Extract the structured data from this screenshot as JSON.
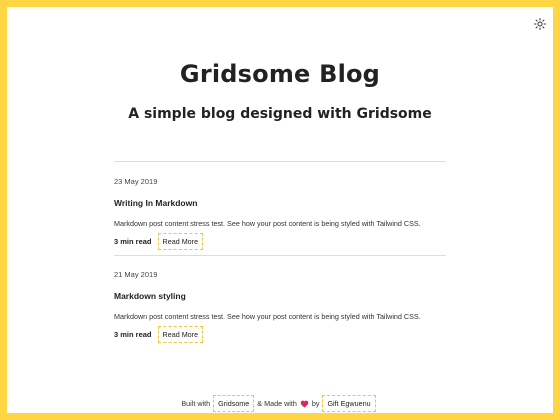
{
  "header": {
    "title": "Gridsome Blog",
    "subtitle": "A simple blog designed with Gridsome",
    "theme_toggle_icon": "sun-icon"
  },
  "posts": [
    {
      "date": "23 May 2019",
      "title": "Writing In Markdown",
      "excerpt": "Markdown post content stress test. See how your post content is being styled with Tailwind CSS.",
      "read_time": "3 min read",
      "read_more": "Read More"
    },
    {
      "date": "21 May 2019",
      "title": "Markdown styling",
      "excerpt": "Markdown post content stress test. See how your post content is being styled with Tailwind CSS.",
      "read_time": "3 min read",
      "read_more": "Read More"
    }
  ],
  "footer": {
    "built_with": "Built with",
    "gridsome_link": "Gridsome",
    "made_with": "& Made with",
    "heart_icon": "heart-icon",
    "by": "by",
    "author_link": "Gift Egwuenu"
  },
  "colors": {
    "frame": "#fdd545",
    "link_border": "#f2c43c",
    "heart": "#e0245e"
  }
}
